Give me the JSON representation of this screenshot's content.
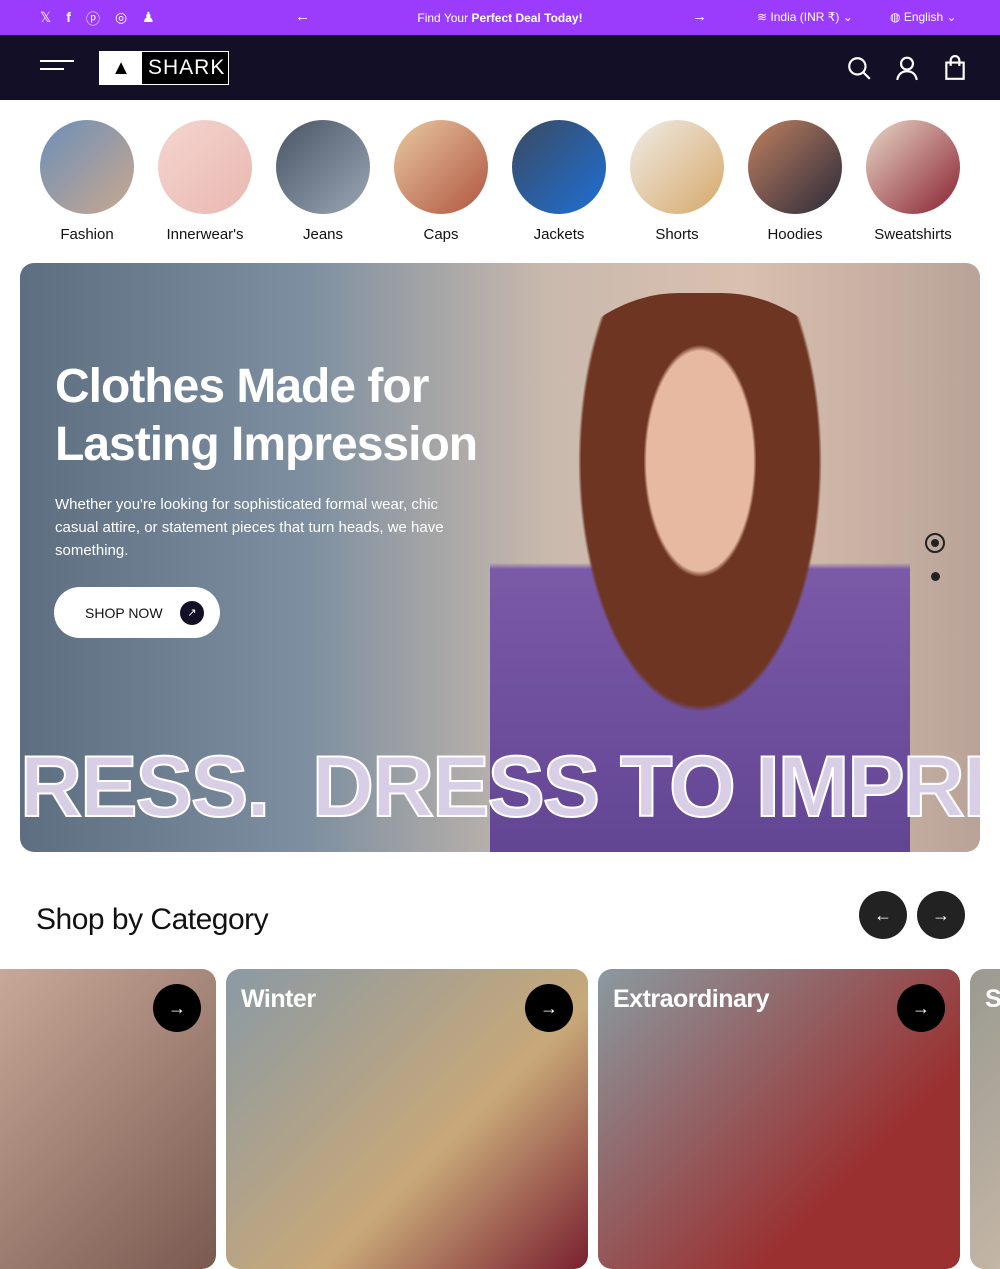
{
  "topbar": {
    "promo_prefix": "Find Your ",
    "promo_bold": "Perfect Deal Today!",
    "location": "India (INR ₹)",
    "language": "English",
    "social": [
      "x-icon",
      "facebook-icon",
      "pinterest-icon",
      "instagram-icon",
      "snapchat-icon"
    ]
  },
  "header": {
    "logo": "SHARK"
  },
  "categories": [
    "Fashion",
    "Innerwear's",
    "Jeans",
    "Caps",
    "Jackets",
    "Shorts",
    "Hoodies",
    "Sweatshirts"
  ],
  "hero": {
    "title_line1": "Clothes Made for",
    "title_line2": "Lasting Impression",
    "description": "Whether you're looking for sophisticated formal wear, chic casual attire, or statement pieces that turn heads, we have something.",
    "button": "SHOP NOW",
    "marquee": "RESS.  DRESS TO IMPRE"
  },
  "shop_by_category": {
    "title": "Shop by Category",
    "cards": [
      "",
      "Winter",
      "Extraordinary",
      "S"
    ]
  },
  "colors": {
    "accent": "#9b3bfb",
    "header": "#130f27"
  }
}
